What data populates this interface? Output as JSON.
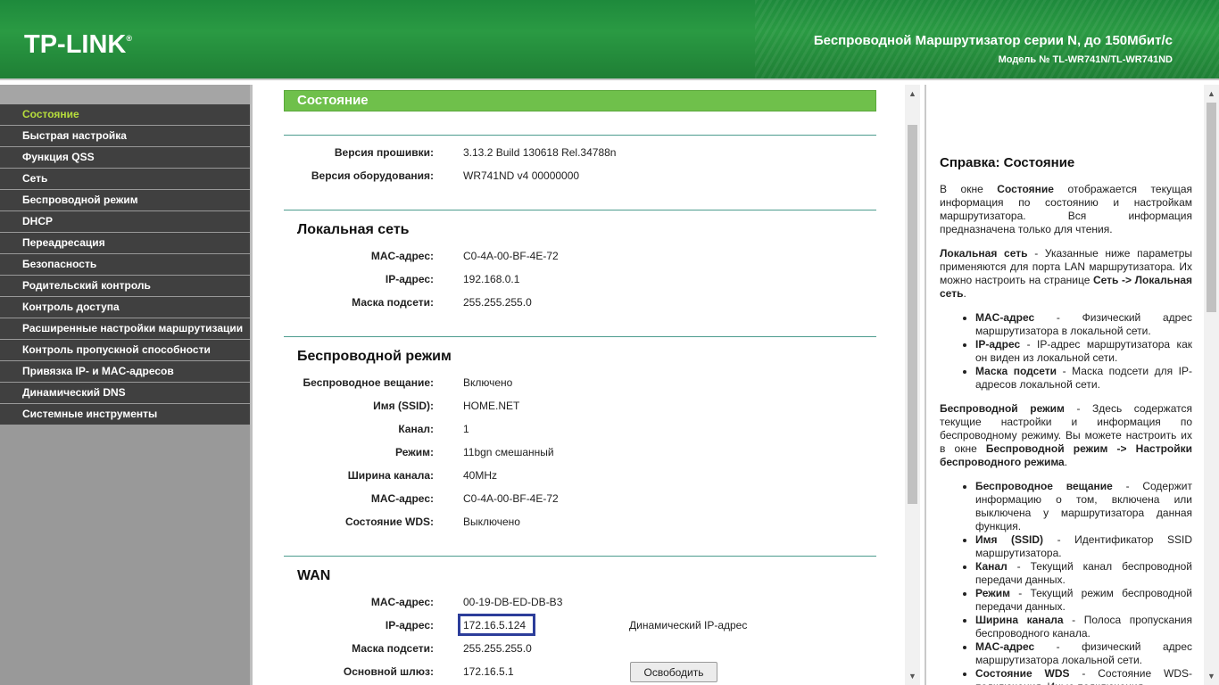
{
  "header": {
    "logo": "TP-LINK",
    "logo_reg": "®",
    "product_title": "Беспроводной Маршрутизатор серии N, до 150Мбит/с",
    "model_line": "Модель № TL-WR741N/TL-WR741ND"
  },
  "sidebar": {
    "items": [
      {
        "label": "Состояние",
        "active": true
      },
      {
        "label": "Быстрая настройка"
      },
      {
        "label": "Функция QSS"
      },
      {
        "label": "Сеть"
      },
      {
        "label": "Беспроводной режим"
      },
      {
        "label": "DHCP"
      },
      {
        "label": "Переадресация"
      },
      {
        "label": "Безопасность"
      },
      {
        "label": "Родительский контроль"
      },
      {
        "label": "Контроль доступа"
      },
      {
        "label": "Расширенные настройки маршрутизации"
      },
      {
        "label": "Контроль пропускной способности"
      },
      {
        "label": "Привязка IP- и MAC-адресов"
      },
      {
        "label": "Динамический DNS"
      },
      {
        "label": "Системные инструменты"
      }
    ]
  },
  "main": {
    "section_title": "Состояние",
    "firmware_label": "Версия прошивки:",
    "firmware_value": "3.13.2 Build 130618 Rel.34788n",
    "hardware_label": "Версия оборудования:",
    "hardware_value": "WR741ND v4 00000000",
    "lan": {
      "title": "Локальная сеть",
      "mac_label": "MAC-адрес:",
      "mac_value": "C0-4A-00-BF-4E-72",
      "ip_label": "IP-адрес:",
      "ip_value": "192.168.0.1",
      "mask_label": "Маска подсети:",
      "mask_value": "255.255.255.0"
    },
    "wireless": {
      "title": "Беспроводной режим",
      "broadcast_label": "Беспроводное вещание:",
      "broadcast_value": "Включено",
      "ssid_label": "Имя (SSID):",
      "ssid_value": "HOME.NET",
      "channel_label": "Канал:",
      "channel_value": "1",
      "mode_label": "Режим:",
      "mode_value": "11bgn смешанный",
      "width_label": "Ширина канала:",
      "width_value": "40MHz",
      "mac_label": "MAC-адрес:",
      "mac_value": "C0-4A-00-BF-4E-72",
      "wds_label": "Состояние WDS:",
      "wds_value": "Выключено"
    },
    "wan": {
      "title": "WAN",
      "mac_label": "MAC-адрес:",
      "mac_value": "00-19-DB-ED-DB-B3",
      "ip_label": "IP-адрес:",
      "ip_value": "172.16.5.124",
      "ip_type": "Динамический IP-адрес",
      "mask_label": "Маска подсети:",
      "mask_value": "255.255.255.0",
      "gateway_label": "Основной шлюз:",
      "gateway_value": "172.16.5.1",
      "release_button": "Освободить"
    }
  },
  "help": {
    "title": "Справка: Состояние",
    "intro_pre": "В окне ",
    "intro_bold": "Состояние",
    "intro_post": " отображается текущая информация по состоянию и настройкам маршрутизатора. Вся информация предназначена только для чтения.",
    "lan_bold": "Локальная сеть",
    "lan_text": " - Указанные ниже параметры применяются для порта LAN маршрутизатора. Их можно настроить на странице ",
    "lan_link": "Сеть -> Локальная сеть",
    "lan_end": ".",
    "lan_items": [
      {
        "term": "MAC-адрес",
        "desc": " - Физический адрес маршрутизатора в локальной сети."
      },
      {
        "term": "IP-адрес",
        "desc": " - IP-адрес маршрутизатора как он виден из локальной сети."
      },
      {
        "term": "Маска подсети",
        "desc": " - Маска подсети для IP-адресов локальной сети."
      }
    ],
    "wl_bold": "Беспроводной режим",
    "wl_text": " - Здесь содержатся текущие настройки и информация по беспроводному режиму. Вы можете настроить их в окне ",
    "wl_link": "Беспроводной режим -> Настройки беспроводного режима",
    "wl_end": ".",
    "wl_items": [
      {
        "term": "Беспроводное вещание",
        "desc": " - Содержит информацию о том, включена или выключена у маршрутизатора данная функция."
      },
      {
        "term": "Имя (SSID)",
        "desc": " - Идентификатор SSID маршрутизатора."
      },
      {
        "term": "Канал",
        "desc": " - Текущий канал беспроводной передачи данных."
      },
      {
        "term": "Режим",
        "desc": " - Текущий режим беспроводной передачи данных."
      },
      {
        "term": "Ширина канала",
        "desc": " - Полоса пропускания беспроводного канала."
      },
      {
        "term": "MAC-адрес",
        "desc": " - физический адрес маршрутизатора локальной сети."
      },
      {
        "term": "Состояние WDS",
        "desc": " - Состояние WDS-подключения. Иные подключения"
      }
    ]
  }
}
